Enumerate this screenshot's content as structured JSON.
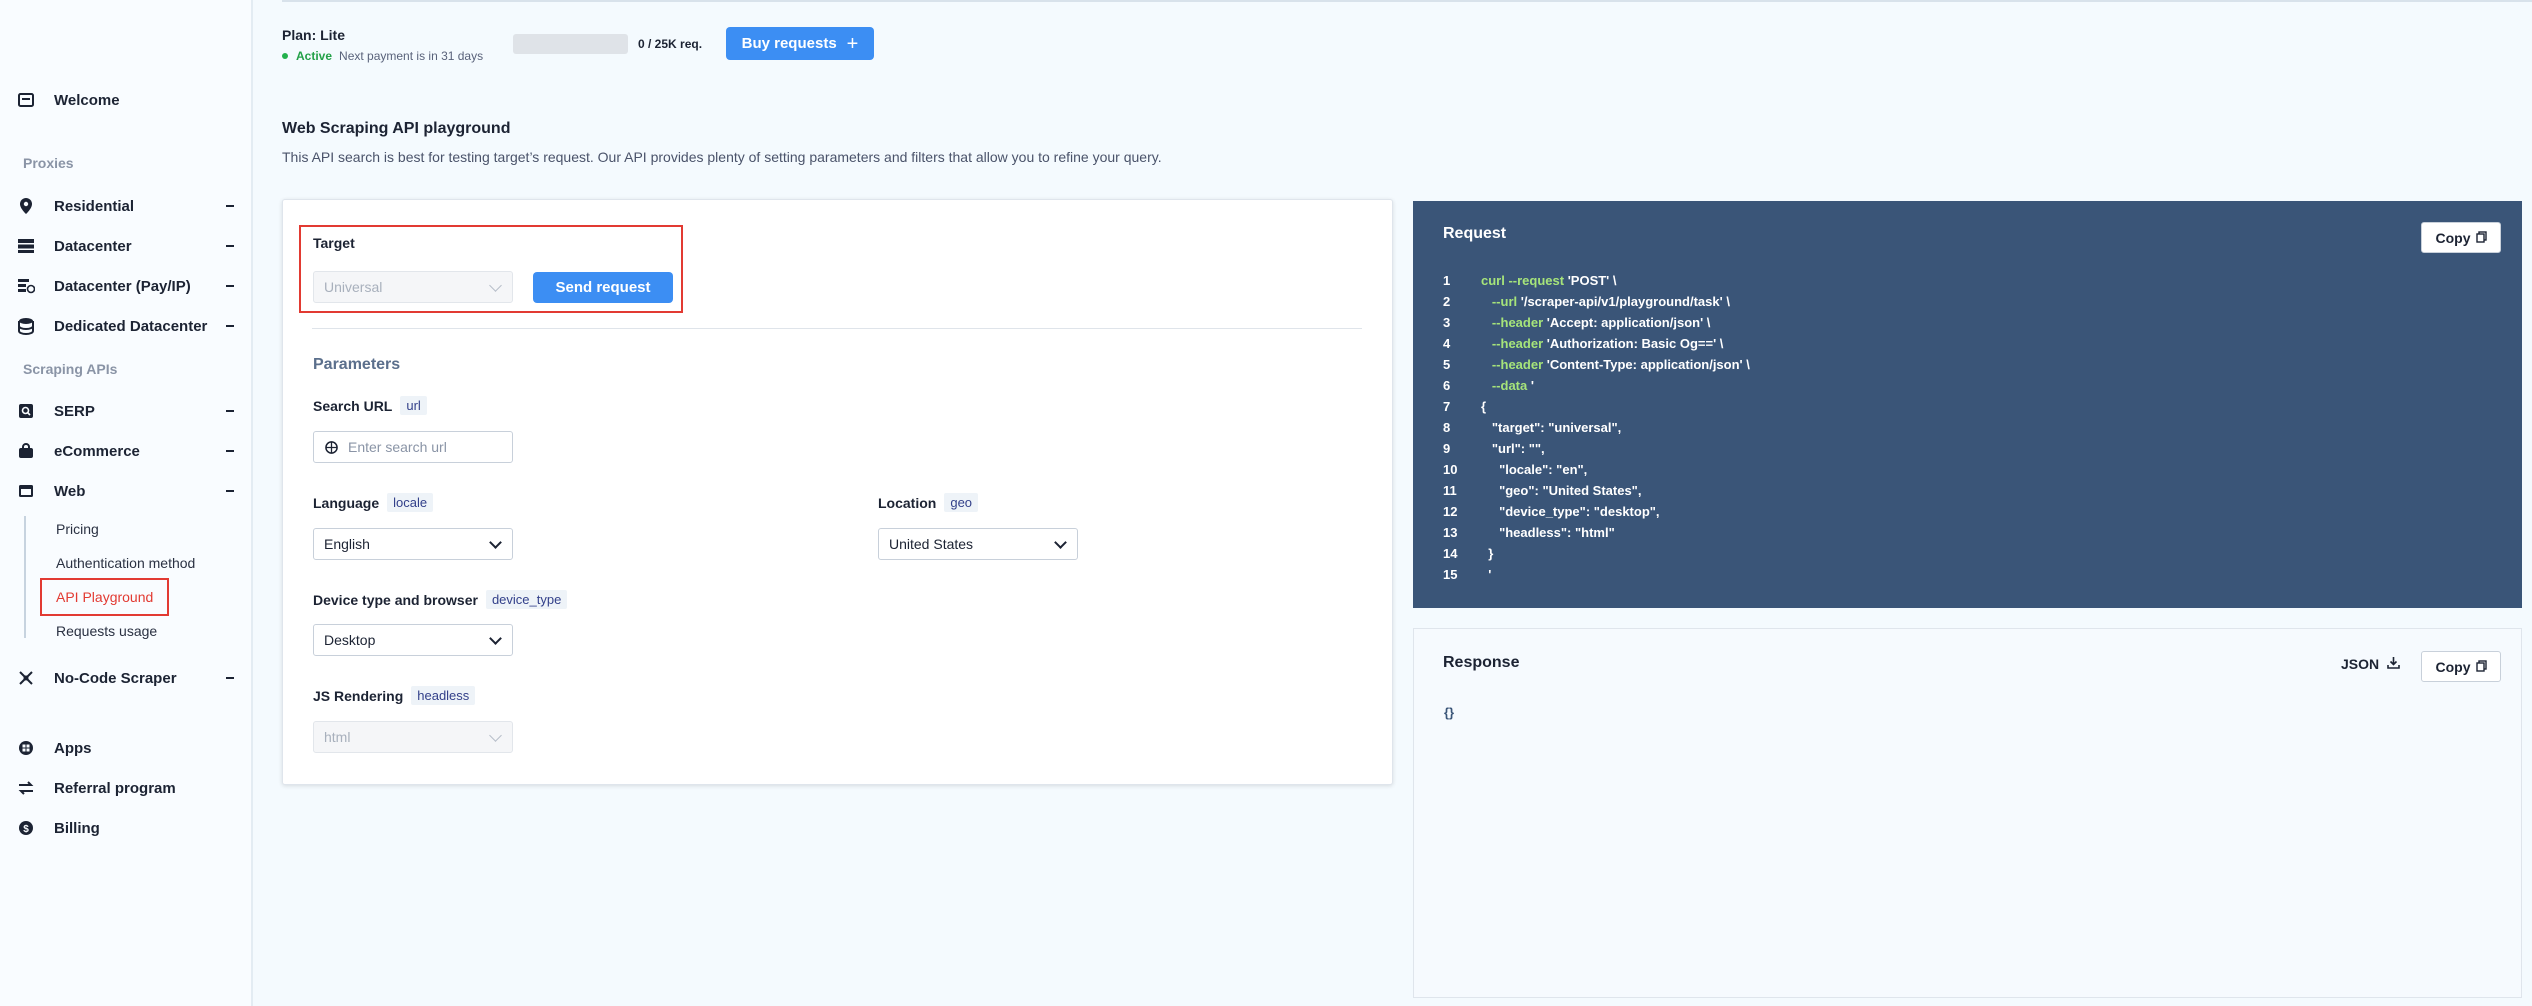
{
  "sidebar": {
    "welcome": "Welcome",
    "proxies_title": "Proxies",
    "residential": "Residential",
    "datacenter": "Datacenter",
    "datacenter_payip": "Datacenter (Pay/IP)",
    "dedicated_datacenter": "Dedicated Datacenter",
    "scraping_title": "Scraping APIs",
    "serp": "SERP",
    "ecommerce": "eCommerce",
    "web": "Web",
    "web_sub": {
      "pricing": "Pricing",
      "auth": "Authentication method",
      "playground": "API Playground",
      "usage": "Requests usage"
    },
    "nocode": "No-Code Scraper",
    "apps": "Apps",
    "referral": "Referral program",
    "billing": "Billing"
  },
  "plan": {
    "title": "Plan: Lite",
    "status": "Active",
    "next_payment": "Next payment is in 31 days",
    "usage": "0 / 25K req.",
    "usage_fraction": 0,
    "buy_label": "Buy requests"
  },
  "page": {
    "title": "Web Scraping API playground",
    "description": "This API search is best for testing target’s request. Our API provides plenty of setting parameters and filters that allow you to refine your query."
  },
  "form": {
    "target_label": "Target",
    "target_value": "Universal",
    "send_label": "Send request",
    "params_title": "Parameters",
    "search_url_label": "Search URL",
    "search_url_tag": "url",
    "search_url_placeholder": "Enter search url",
    "language_label": "Language",
    "language_tag": "locale",
    "language_value": "English",
    "location_label": "Location",
    "location_tag": "geo",
    "location_value": "United States",
    "device_label": "Device type and browser",
    "device_tag": "device_type",
    "device_value": "Desktop",
    "js_label": "JS Rendering",
    "js_tag": "headless",
    "js_value": "html"
  },
  "request": {
    "title": "Request",
    "copy_label": "Copy",
    "lines": [
      {
        "n": "1",
        "indent": "",
        "kw": "curl --request",
        "rest": " 'POST' \\"
      },
      {
        "n": "2",
        "indent": "   ",
        "kw": "--url",
        "rest": " '/scraper-api/v1/playground/task' \\"
      },
      {
        "n": "3",
        "indent": "   ",
        "kw": "--header",
        "rest": " 'Accept: application/json' \\"
      },
      {
        "n": "4",
        "indent": "   ",
        "kw": "--header",
        "rest": " 'Authorization: Basic Og==' \\"
      },
      {
        "n": "5",
        "indent": "   ",
        "kw": "--header",
        "rest": " 'Content-Type: application/json' \\"
      },
      {
        "n": "6",
        "indent": "   ",
        "kw": "--data",
        "rest": " '"
      },
      {
        "n": "7",
        "indent": "",
        "kw": "",
        "rest": "{"
      },
      {
        "n": "8",
        "indent": "   ",
        "kw": "",
        "rest": "\"target\": \"universal\","
      },
      {
        "n": "9",
        "indent": "   ",
        "kw": "",
        "rest": "\"url\": \"\","
      },
      {
        "n": "10",
        "indent": "     ",
        "kw": "",
        "rest": "\"locale\": \"en\","
      },
      {
        "n": "11",
        "indent": "     ",
        "kw": "",
        "rest": "\"geo\": \"United States\","
      },
      {
        "n": "12",
        "indent": "     ",
        "kw": "",
        "rest": "\"device_type\": \"desktop\","
      },
      {
        "n": "13",
        "indent": "     ",
        "kw": "",
        "rest": "\"headless\": \"html\""
      },
      {
        "n": "14",
        "indent": "  ",
        "kw": "",
        "rest": "}"
      },
      {
        "n": "15",
        "indent": "  ",
        "kw": "",
        "rest": "'"
      }
    ]
  },
  "response": {
    "title": "Response",
    "json_label": "JSON",
    "copy_label": "Copy",
    "body": "{}"
  }
}
